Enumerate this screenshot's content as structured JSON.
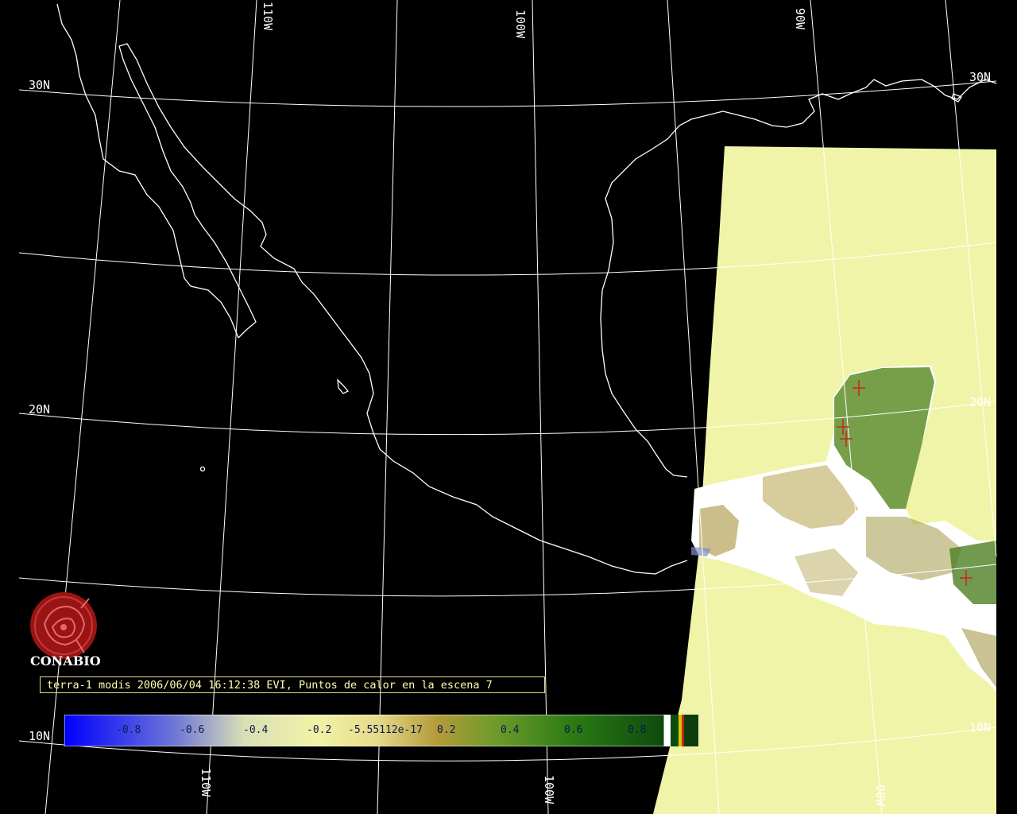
{
  "grid_labels": {
    "lat_30n_left": "30N",
    "lat_30n_right": "30N",
    "lat_20n_left": "20N",
    "lat_20n_right": "20N",
    "lat_10n_left": "10N",
    "lat_10n_right": "10N",
    "lon_110w_top": "110W",
    "lon_100w_top": "100W",
    "lon_90w_top": "90W",
    "lon_110w_bottom": "110W",
    "lon_100w_bottom": "100W",
    "lon_90w_bottom": "90W"
  },
  "logo": {
    "text": "CONABIO",
    "color": "#9a1414"
  },
  "caption": "terra-1 modis 2006/06/04 16:12:38 EVI, Puntos de calor en la escena 7",
  "colorbar": {
    "ticks": [
      "-0.8",
      "-0.6",
      "-0.4",
      "-0.2",
      "-5.55112e-17",
      "0.2",
      "0.4",
      "0.6",
      "0.8"
    ],
    "colors": {
      "low": "#0000ff",
      "mid_low": "#f2f2a6",
      "zero": "#b59b3a",
      "high": "#0d4a0d"
    }
  },
  "colors": {
    "background": "#000000",
    "coastline": "#ffffff",
    "grid": "#ffffff",
    "scene_fill": "#f0f4a8",
    "vegetation": "#4a7a1e",
    "hotspot": "#cc2222"
  }
}
